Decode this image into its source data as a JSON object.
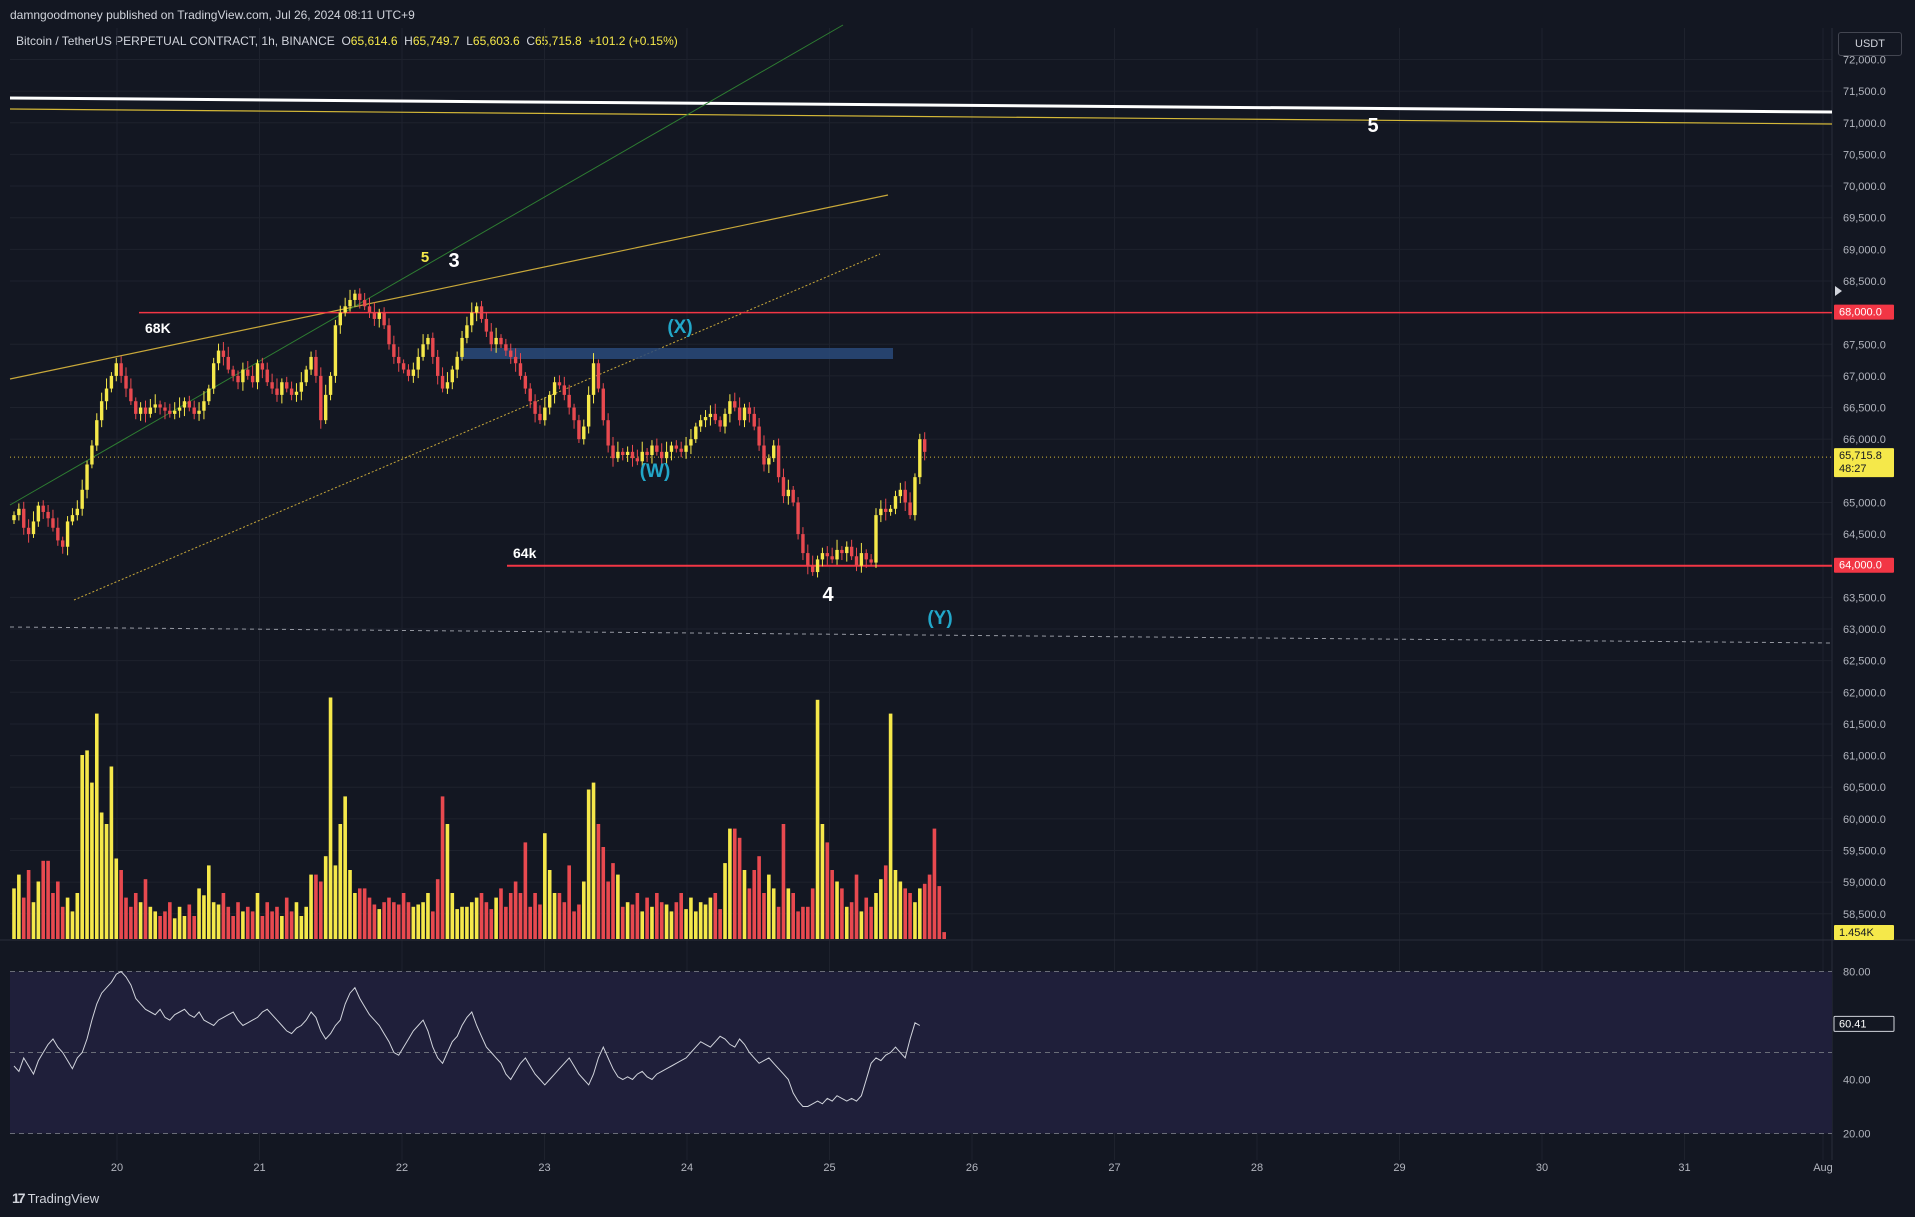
{
  "header": {
    "published": "damngoodmoney published on TradingView.com, Jul 26, 2024 08:11 UTC+9"
  },
  "legend": {
    "symbol": "Bitcoin / TetherUS PERPETUAL CONTRACT, 1h, BINANCE",
    "o_label": "O",
    "o_value": "65,614.6",
    "h_label": "H",
    "h_value": "65,749.7",
    "l_label": "L",
    "l_value": "65,603.6",
    "c_label": "C",
    "c_value": "65,715.8",
    "change": "+101.2 (+0.15%)"
  },
  "currency_button": "USDT",
  "footer": {
    "brand": "TradingView"
  },
  "colors": {
    "background": "#131722",
    "up": "#f5e84a",
    "down": "#e8494f",
    "grid": "#1e222d",
    "level": "#f23645",
    "wave_cyan": "#22a7c9",
    "box": "#2a4a7a"
  },
  "chart_data": {
    "type": "candlestick",
    "price_axis": {
      "ticks": [
        "72,000.0",
        "71,500.0",
        "71,000.0",
        "70,500.0",
        "70,000.0",
        "69,500.0",
        "69,000.0",
        "68,500.0",
        "67,500.0",
        "67,000.0",
        "66,500.0",
        "66,000.0",
        "65,000.0",
        "64,500.0",
        "63,500.0",
        "63,000.0",
        "62,500.0",
        "62,000.0",
        "61,500.0",
        "61,000.0",
        "60,500.0",
        "60,000.0",
        "59,500.0",
        "59,000.0",
        "58,500.0"
      ],
      "range": [
        58000,
        72500
      ]
    },
    "date_axis": {
      "ticks": [
        "20",
        "21",
        "22",
        "23",
        "24",
        "25",
        "26",
        "27",
        "28",
        "29",
        "30",
        "31",
        "Aug"
      ]
    },
    "badges": {
      "level_68000": "68,000.0",
      "level_64000": "64,000.0",
      "last_price": "65,715.8",
      "countdown": "48:27",
      "volume": "1.454K",
      "rsi": "60.41"
    },
    "rsi_axis": {
      "ticks": [
        "80.00",
        "60.00",
        "40.00",
        "20.00"
      ],
      "range": [
        15,
        85
      ]
    },
    "annotations": {
      "wave_5_top": "5",
      "wave_5_small": "5",
      "wave_3": "3",
      "wave_4": "4",
      "wave_w": "(W)",
      "wave_x": "(X)",
      "wave_y": "(Y)",
      "label_68k": "68K",
      "label_64k": "64k"
    },
    "levels": [
      68000,
      64000
    ],
    "closes": [
      64800,
      64900,
      64600,
      64500,
      64700,
      64950,
      64850,
      64750,
      64600,
      64400,
      64300,
      64700,
      64800,
      64900,
      65200,
      65600,
      65900,
      66300,
      66600,
      66800,
      67000,
      67200,
      67000,
      66800,
      66600,
      66400,
      66500,
      66400,
      66500,
      66550,
      66500,
      66450,
      66400,
      66450,
      66500,
      66600,
      66500,
      66400,
      66450,
      66600,
      66800,
      67200,
      67400,
      67300,
      67100,
      67000,
      66900,
      67100,
      67000,
      66900,
      67200,
      67100,
      66900,
      66800,
      66700,
      66900,
      66800,
      66700,
      66750,
      66900,
      67100,
      67300,
      67000,
      66300,
      66700,
      67000,
      67800,
      68000,
      68100,
      68200,
      68300,
      68200,
      68100,
      68000,
      67900,
      68000,
      67800,
      67500,
      67300,
      67200,
      67100,
      67000,
      67100,
      67300,
      67500,
      67600,
      67300,
      67000,
      66800,
      66900,
      67100,
      67300,
      67600,
      67800,
      68000,
      68100,
      67900,
      67700,
      67500,
      67600,
      67500,
      67400,
      67300,
      67200,
      67000,
      66800,
      66600,
      66400,
      66300,
      66500,
      66700,
      66900,
      66850,
      66700,
      66500,
      66300,
      66000,
      66200,
      66700,
      67200,
      66800,
      66300,
      65900,
      65700,
      65800,
      65750,
      65800,
      65700,
      65650,
      65800,
      65750,
      65900,
      65800,
      65700,
      65800,
      65900,
      65850,
      65800,
      65900,
      66000,
      66200,
      66300,
      66350,
      66400,
      66300,
      66200,
      66400,
      66600,
      66500,
      66300,
      66500,
      66400,
      66200,
      65900,
      65600,
      65700,
      65900,
      65400,
      65100,
      65200,
      65000,
      64500,
      64200,
      64000,
      63900,
      64100,
      64200,
      64150,
      64100,
      64250,
      64200,
      64300,
      64150,
      64000,
      64200,
      64100,
      64050,
      64800,
      64900,
      64850,
      64900,
      65100,
      65200,
      65000,
      64800,
      65400,
      66000,
      65800
    ],
    "volumes": [
      0.22,
      0.28,
      0.18,
      0.3,
      0.16,
      0.25,
      0.34,
      0.34,
      0.2,
      0.25,
      0.14,
      0.18,
      0.12,
      0.2,
      0.8,
      0.82,
      0.68,
      0.98,
      0.55,
      0.5,
      0.75,
      0.35,
      0.3,
      0.18,
      0.14,
      0.2,
      0.16,
      0.26,
      0.14,
      0.12,
      0.1,
      0.12,
      0.16,
      0.09,
      0.14,
      0.1,
      0.15,
      0.1,
      0.22,
      0.19,
      0.32,
      0.16,
      0.15,
      0.2,
      0.14,
      0.1,
      0.16,
      0.12,
      0.14,
      0.12,
      0.2,
      0.1,
      0.16,
      0.12,
      0.14,
      0.1,
      0.18,
      0.12,
      0.16,
      0.1,
      0.14,
      0.28,
      0.28,
      0.25,
      0.36,
      1.05,
      0.32,
      0.5,
      0.62,
      0.3,
      0.2,
      0.22,
      0.22,
      0.18,
      0.15,
      0.13,
      0.16,
      0.18,
      0.16,
      0.15,
      0.2,
      0.16,
      0.14,
      0.15,
      0.16,
      0.2,
      0.12,
      0.26,
      0.62,
      0.5,
      0.2,
      0.13,
      0.14,
      0.14,
      0.16,
      0.18,
      0.2,
      0.16,
      0.13,
      0.18,
      0.22,
      0.14,
      0.2,
      0.25,
      0.2,
      0.42,
      0.14,
      0.2,
      0.15,
      0.46,
      0.3,
      0.2,
      0.2,
      0.16,
      0.32,
      0.12,
      0.15,
      0.25,
      0.65,
      0.68,
      0.5,
      0.4,
      0.25,
      0.33,
      0.28,
      0.14,
      0.16,
      0.15,
      0.2,
      0.12,
      0.18,
      0.14,
      0.2,
      0.16,
      0.15,
      0.12,
      0.16,
      0.2,
      0.13,
      0.18,
      0.12,
      0.16,
      0.15,
      0.18,
      0.2,
      0.13,
      0.33,
      0.48,
      0.48,
      0.44,
      0.3,
      0.22,
      0.3,
      0.36,
      0.2,
      0.28,
      0.22,
      0.14,
      0.5,
      0.22,
      0.2,
      0.12,
      0.14,
      0.14,
      0.22,
      1.04,
      0.5,
      0.42,
      0.3,
      0.25,
      0.22,
      0.14,
      0.16,
      0.28,
      0.12,
      0.18,
      0.14,
      0.2,
      0.26,
      0.32,
      0.98,
      0.3,
      0.25,
      0.22,
      0.2,
      0.16,
      0.22,
      0.24,
      0.28,
      0.48,
      0.23,
      0.03
    ],
    "rsi": [
      45,
      43,
      48,
      45,
      42,
      47,
      50,
      53,
      55,
      52,
      50,
      47,
      44,
      48,
      50,
      55,
      62,
      68,
      72,
      74,
      76,
      79,
      80,
      78,
      75,
      70,
      68,
      66,
      65,
      64,
      66,
      63,
      62,
      64,
      65,
      66,
      64,
      63,
      65,
      62,
      61,
      60,
      62,
      63,
      64,
      65,
      62,
      60,
      61,
      62,
      63,
      65,
      66,
      64,
      62,
      60,
      58,
      57,
      59,
      60,
      62,
      65,
      63,
      58,
      55,
      57,
      60,
      62,
      68,
      72,
      74,
      70,
      67,
      64,
      62,
      60,
      57,
      54,
      50,
      49,
      52,
      55,
      58,
      60,
      62,
      58,
      52,
      48,
      46,
      50,
      54,
      56,
      60,
      63,
      65,
      60,
      56,
      52,
      50,
      48,
      46,
      42,
      40,
      43,
      46,
      48,
      45,
      42,
      40,
      38,
      40,
      42,
      44,
      46,
      48,
      45,
      42,
      40,
      38,
      42,
      48,
      52,
      48,
      44,
      41,
      40,
      41,
      40,
      42,
      43,
      41,
      40,
      42,
      43,
      44,
      45,
      46,
      47,
      48,
      50,
      52,
      54,
      53,
      52,
      54,
      56,
      55,
      53,
      52,
      55,
      53,
      50,
      48,
      46,
      47,
      48,
      46,
      44,
      42,
      40,
      35,
      32,
      30,
      30,
      31,
      32,
      31,
      33,
      32,
      34,
      33,
      32,
      33,
      32,
      34,
      40,
      46,
      48,
      47,
      49,
      50,
      52,
      50,
      48,
      55,
      61,
      60
    ]
  }
}
